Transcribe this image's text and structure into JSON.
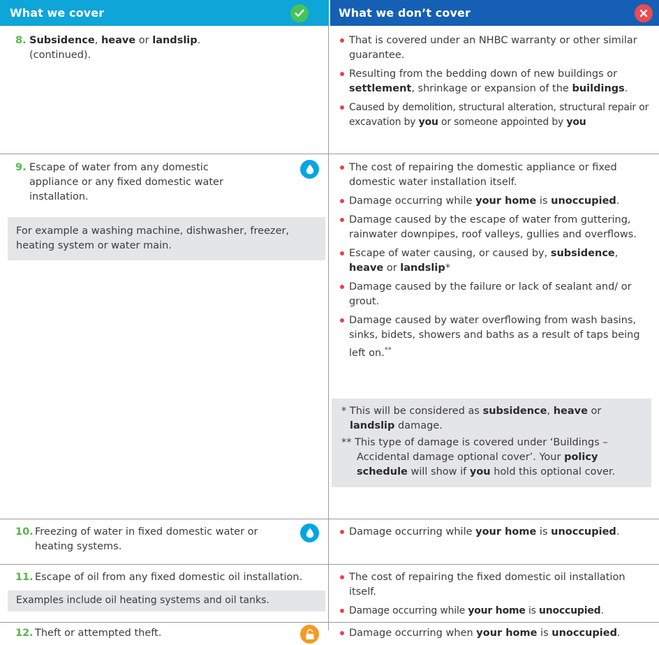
{
  "header": {
    "cover_title": "What we cover",
    "not_cover_title": "What we don’t cover"
  },
  "icons": {
    "check": "check-icon",
    "cross": "cross-icon",
    "water": "water-drop-icon",
    "theft": "padlock-icon"
  },
  "colors": {
    "cover_header": "#0ea5d8",
    "not_cover_header": "#1560b4",
    "number": "#55b748",
    "bullet": "#e8424d",
    "note_bg": "#e4e5e7"
  },
  "section8": {
    "number": "8.",
    "subsidence": "Subsidence",
    "heave": "heave",
    "or": "or",
    "landslip": "landslip",
    "continued": "(continued).",
    "b1": "That is covered under an NHBC warranty or other similar guarantee.",
    "b2_a": "Resulting from the bedding down of new buildings or",
    "b2_settlement": "settlement",
    "b2_b": ", shrinkage or expansion of the",
    "b2_buildings": "buildings",
    "b3_a": "Caused by demolition, structural alteration, structural repair or excavation by",
    "b3_you1": "you",
    "b3_b": "or someone appointed by",
    "b3_you2": "you"
  },
  "section9": {
    "number": "9.",
    "text": "Escape of water from any domestic appliance or any fixed domestic water installation.",
    "example": "For example a washing machine, dishwasher, freezer, heating system or water main.",
    "b1": "The cost of repairing the domestic appliance or fixed domestic water installation itself.",
    "b2_a": "Damage occurring while",
    "b2_home": "your home",
    "b2_is": "is",
    "b2_unoccupied": "unoccupied",
    "b3": "Damage caused by the escape of water from guttering, rainwater downpipes, roof valleys, gullies and overflows.",
    "b4_a": "Escape of water causing, or caused by,",
    "b4_subsidence": "subsidence",
    "b4_heave": "heave",
    "b4_or": "or",
    "b4_landslip": "landslip",
    "b4_star": "*",
    "b5": "Damage caused by the failure or lack of sealant and/ or grout.",
    "b6": "Damage caused by water overflowing from wash basins, sinks, bidets, showers and baths as a result of taps being left on.",
    "b6_stars": "**",
    "fn1_a": "* This will be considered as",
    "fn1_subsidence": "subsidence",
    "fn1_heave": "heave",
    "fn1_or": "or",
    "fn1_landslip": "landslip",
    "fn1_b": "damage.",
    "fn2_a": "** This type of damage is covered under ‘Buildings – Accidental damage optional cover’. Your",
    "fn2_policy": "policy schedule",
    "fn2_b": "will show if",
    "fn2_you": "you",
    "fn2_c": "hold this optional cover."
  },
  "section10": {
    "number": "10.",
    "text": "Freezing of water in fixed domestic water or heating systems.",
    "b1_a": "Damage occurring while",
    "b1_home": "your home",
    "b1_is": "is",
    "b1_unoccupied": "unoccupied"
  },
  "section11": {
    "number": "11.",
    "text": "Escape of oil from any fixed domestic oil installation.",
    "example": "Examples include oil heating systems and oil tanks.",
    "b1": "The cost of repairing the fixed domestic oil installation itself.",
    "b2_a": "Damage occurring while",
    "b2_home": "your home",
    "b2_is": "is",
    "b2_unoccupied": "unoccupied"
  },
  "section12": {
    "number": "12.",
    "text": "Theft or attempted theft.",
    "b1_a": "Damage occurring when",
    "b1_home": "your home",
    "b1_is": "is",
    "b1_unoccupied": "unoccupied"
  }
}
